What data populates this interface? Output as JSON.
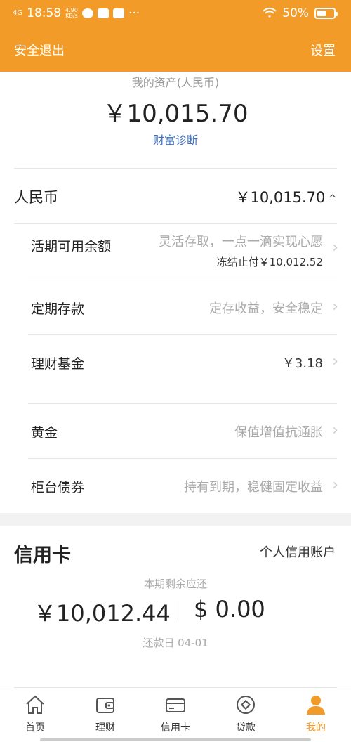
{
  "status_bar": {
    "network": "4G",
    "time": "18:58",
    "speed_value": "4.90",
    "speed_unit": "KB/s",
    "more": "···",
    "battery": "50%"
  },
  "header": {
    "left_label": "安全退出",
    "right_label": "设置"
  },
  "assets": {
    "label": "我的资产(人民币)",
    "value": "￥10,015.70",
    "link": "财富诊断"
  },
  "rmb": {
    "title": "人民币",
    "value": "￥10,015.70",
    "caret": "^"
  },
  "items": [
    {
      "title": "活期可用余额",
      "desc": "灵活存取，一点一滴实现心愿",
      "sub": "冻结止付￥10,012.52"
    },
    {
      "title": "定期存款",
      "desc": "定存收益，安全稳定"
    },
    {
      "title": "理财基金",
      "desc": "￥3.18"
    },
    {
      "title": "黄金",
      "desc": "保值增值抗通胀"
    },
    {
      "title": "柜台债券",
      "desc": "持有到期，稳健固定收益"
    }
  ],
  "credit": {
    "title": "信用卡",
    "link": "个人信用账户",
    "label": "本期剩余应还",
    "amount_cny": "￥10,012.44",
    "amount_usd": "$ 0.00",
    "due": "还款日 04-01"
  },
  "tabs": [
    {
      "label": "首页",
      "icon": "home-icon"
    },
    {
      "label": "理财",
      "icon": "wallet-icon"
    },
    {
      "label": "信用卡",
      "icon": "credit-card-icon"
    },
    {
      "label": "贷款",
      "icon": "loan-icon"
    },
    {
      "label": "我的",
      "icon": "user-icon"
    }
  ],
  "colors": {
    "brand": "#f39b28",
    "link": "#3a6fbf"
  }
}
